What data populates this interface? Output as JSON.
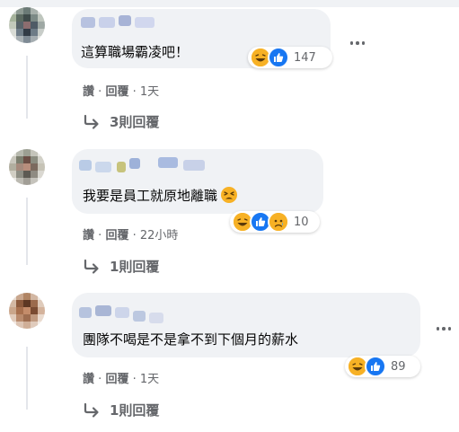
{
  "comments": [
    {
      "text": "這算職場霸凌吧！",
      "reaction_count": "147",
      "reactions": [
        "haha-icon",
        "like-icon"
      ],
      "actions": {
        "like": "讚",
        "reply": "回覆",
        "time": "1天"
      },
      "replies_label": "3則回覆"
    },
    {
      "text": "我要是員工就原地離職",
      "inline_emoji": "tired-face-emoji",
      "reaction_count": "10",
      "reactions": [
        "haha-icon",
        "like-icon",
        "sad-icon"
      ],
      "actions": {
        "like": "讚",
        "reply": "回覆",
        "time": "22小時"
      },
      "replies_label": "1則回覆"
    },
    {
      "text": "團隊不喝是不是拿不到下個月的薪水",
      "reaction_count": "89",
      "reactions": [
        "haha-icon",
        "like-icon"
      ],
      "actions": {
        "like": "讚",
        "reply": "回覆",
        "time": "1天"
      },
      "replies_label": "1則回覆"
    }
  ],
  "separator": "·",
  "colors": {
    "bubble": "#f0f2f5",
    "secondary_text": "#65676b",
    "like_blue": "#1877f2",
    "haha_yellow": "#f7b125"
  }
}
